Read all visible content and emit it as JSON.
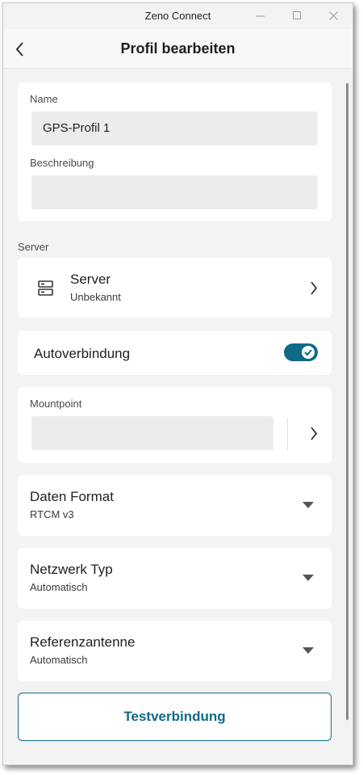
{
  "window": {
    "title": "Zeno Connect"
  },
  "header": {
    "title": "Profil bearbeiten"
  },
  "profile": {
    "name_label": "Name",
    "name_value": "GPS-Profil 1",
    "description_label": "Beschreibung",
    "description_value": ""
  },
  "server_section": {
    "label": "Server",
    "title": "Server",
    "subtitle": "Unbekannt",
    "icon": "server-icon"
  },
  "autoconnect": {
    "label": "Autoverbindung",
    "enabled": true
  },
  "mountpoint": {
    "label": "Mountpoint",
    "value": ""
  },
  "data_format": {
    "label": "Daten Format",
    "value": "RTCM v3"
  },
  "network_type": {
    "label": "Netzwerk Typ",
    "value": "Automatisch"
  },
  "reference_antenna": {
    "label": "Referenzantenne",
    "value": "Automatisch"
  },
  "test_button": {
    "label": "Testverbindung"
  },
  "colors": {
    "accent": "#0e6a86",
    "card": "#ffffff",
    "background": "#f3f3f3",
    "field": "#ececec"
  }
}
